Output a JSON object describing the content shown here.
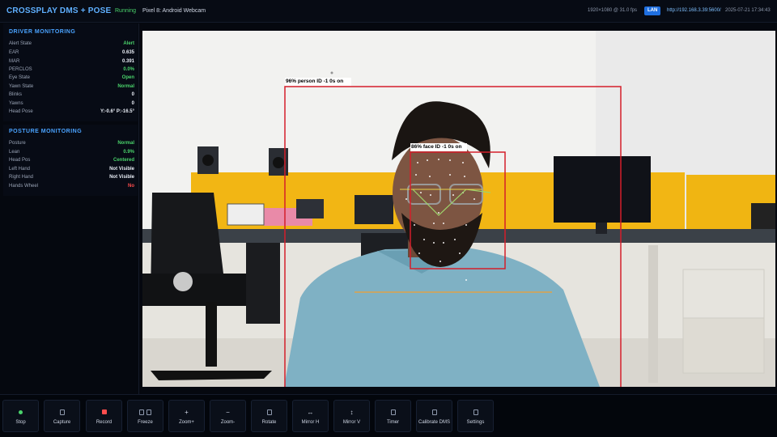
{
  "header": {
    "title": "CROSSPLAY DMS + POSE",
    "status": "Running",
    "source": "Pixel 8: Android Webcam",
    "resolution": "1920×1080 @ 31.0 fps",
    "lan_badge": "LAN",
    "url": "http://192.168.3.39:5600/",
    "datetime": "2025-07-21 17:34:43"
  },
  "driver": {
    "title": "DRIVER MONITORING",
    "rows": [
      {
        "label": "Alert State",
        "value": "Alert"
      },
      {
        "label": "EAR",
        "value": "0.635"
      },
      {
        "label": "MAR",
        "value": "0.391"
      },
      {
        "label": "PERCLOS",
        "value": "0.0%"
      },
      {
        "label": "Eye State",
        "value": "Open"
      },
      {
        "label": "Yawn State",
        "value": "Normal"
      },
      {
        "label": "Blinks",
        "value": "0"
      },
      {
        "label": "Yawns",
        "value": "0"
      },
      {
        "label": "Head Pose",
        "value": "Y:-0.6° P:-16.5°"
      }
    ]
  },
  "posture": {
    "title": "POSTURE MONITORING",
    "rows": [
      {
        "label": "Posture",
        "value": "Normal"
      },
      {
        "label": "Lean",
        "value": "0.9%"
      },
      {
        "label": "Head Pos",
        "value": "Centered"
      },
      {
        "label": "Left Hand",
        "value": "Not Visible"
      },
      {
        "label": "Right Hand",
        "value": "Not Visible"
      },
      {
        "label": "Hands Wheel",
        "value": "No"
      }
    ]
  },
  "detections": {
    "person_label": "96% person ID -1 0s on",
    "face_label": "86% face ID -1 0s on"
  },
  "toolbar": [
    {
      "label": "Stop",
      "icon": "stop-icon"
    },
    {
      "label": "Capture",
      "icon": "camera-icon"
    },
    {
      "label": "Record",
      "icon": "record-icon"
    },
    {
      "label": "Freeze",
      "icon": "freeze-icon"
    },
    {
      "label": "Zoom+",
      "glyph": "+",
      "icon": "zoom-in-icon"
    },
    {
      "label": "Zoom-",
      "glyph": "−",
      "icon": "zoom-out-icon"
    },
    {
      "label": "Rotate",
      "icon": "rotate-icon"
    },
    {
      "label": "Mirror H",
      "glyph": "↔",
      "icon": "mirror-h-icon"
    },
    {
      "label": "Mirror V",
      "glyph": "↕",
      "icon": "mirror-v-icon"
    },
    {
      "label": "Timer",
      "icon": "timer-icon"
    },
    {
      "label": "Calibrate DMS",
      "icon": "calibrate-icon"
    },
    {
      "label": "Settings",
      "icon": "settings-icon"
    }
  ],
  "colors": {
    "accent": "#4aa3ff",
    "ok": "#4ad36b",
    "alert": "#ff4d4d",
    "box": "#d41e2a"
  }
}
